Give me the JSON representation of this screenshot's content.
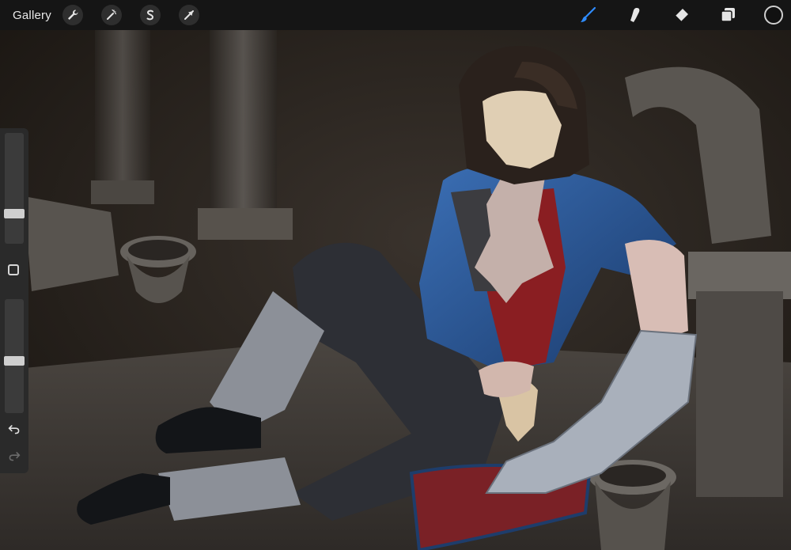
{
  "app": {
    "gallery_label": "Gallery"
  },
  "toolbar_left": [
    {
      "name": "actions",
      "icon": "wrench-icon"
    },
    {
      "name": "adjustments",
      "icon": "magic-wand-icon"
    },
    {
      "name": "selection",
      "icon": "selection-s-icon"
    },
    {
      "name": "transform",
      "icon": "arrow-cursor-icon"
    }
  ],
  "toolbar_right": [
    {
      "name": "brush",
      "icon": "brush-icon",
      "active": true
    },
    {
      "name": "smudge",
      "icon": "smudge-finger-icon",
      "active": false
    },
    {
      "name": "eraser",
      "icon": "eraser-icon",
      "active": false
    },
    {
      "name": "layers",
      "icon": "layers-icon",
      "active": false
    }
  ],
  "colors": {
    "toolbar_bg": "#151515",
    "accent_active": "#2f8cff",
    "current_color": "#111111",
    "sidebar_bg": "#2a2a2a"
  },
  "sidebar": {
    "brush_size_level": 0.35,
    "opacity_level": 0.45,
    "modify_icon": "square-icon",
    "undo_icon": "undo-icon",
    "redo_icon": "redo-icon"
  }
}
